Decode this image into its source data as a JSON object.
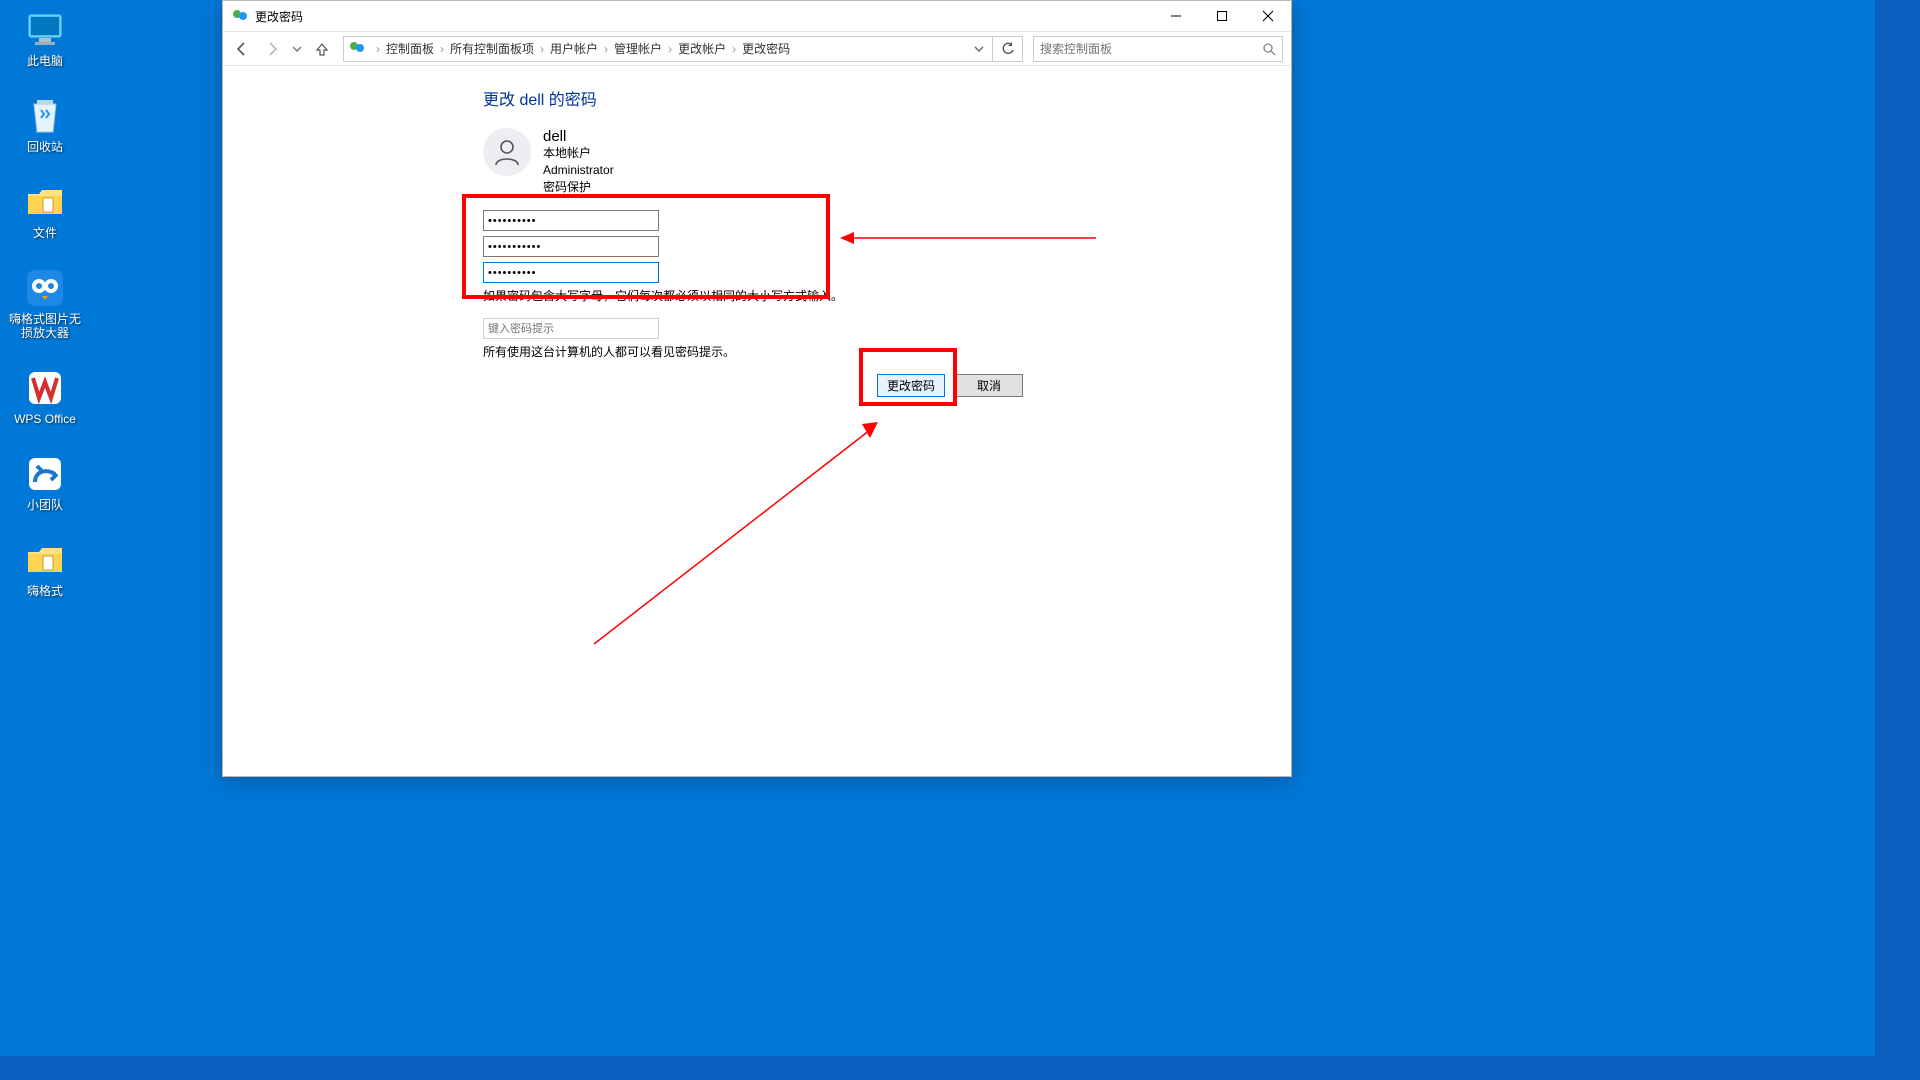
{
  "desktop": {
    "icons": [
      {
        "name": "此电脑"
      },
      {
        "name": "回收站"
      },
      {
        "name": "文件"
      },
      {
        "name": "嗨格式图片无\n损放大器"
      },
      {
        "name": "WPS Office"
      },
      {
        "name": "小团队"
      },
      {
        "name": "嗨格式"
      }
    ]
  },
  "window": {
    "title": "更改密码",
    "breadcrumbs": [
      "控制面板",
      "所有控制面板项",
      "用户帐户",
      "管理帐户",
      "更改帐户",
      "更改密码"
    ],
    "search_placeholder": "搜索控制面板",
    "page": {
      "heading": "更改 dell 的密码",
      "user": {
        "name": "dell",
        "line1": "本地帐户",
        "line2": "Administrator",
        "line3": "密码保护"
      },
      "pw1": "••••••••••",
      "pw2": "•••••••••••",
      "pw3": "••••••••••",
      "caps_notice": "如果密码包含大写字母，它们每次都必须以相同的大小写方式输入。",
      "hint_placeholder": "键入密码提示",
      "hint_notice": "所有使用这台计算机的人都可以看见密码提示。",
      "change_btn": "更改密码",
      "cancel_btn": "取消"
    }
  }
}
